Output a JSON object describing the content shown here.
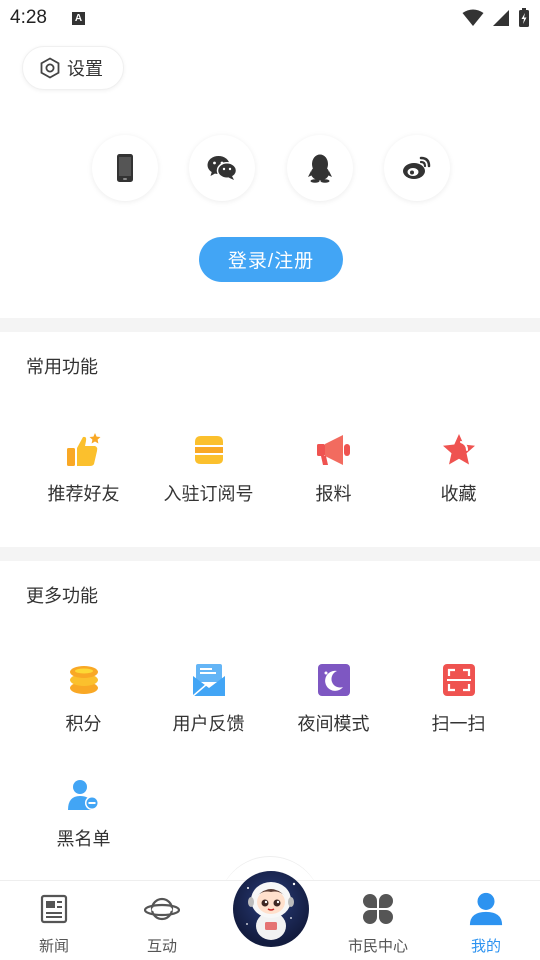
{
  "status_bar": {
    "time": "4:28",
    "notification_icon": "A"
  },
  "settings": {
    "label": "设置",
    "icon": "hexagon-gear-icon"
  },
  "social_logins": [
    {
      "name": "phone-icon"
    },
    {
      "name": "wechat-icon"
    },
    {
      "name": "qq-icon"
    },
    {
      "name": "weibo-icon"
    }
  ],
  "login_button": {
    "label": "登录/注册",
    "color": "#42a5f5"
  },
  "common_functions": {
    "title": "常用功能",
    "items": [
      {
        "label": "推荐好友",
        "icon": "thumbs-up-icon",
        "color": "#f9a825"
      },
      {
        "label": "入驻订阅号",
        "icon": "store-icon",
        "color": "#f9a825"
      },
      {
        "label": "报料",
        "icon": "megaphone-icon",
        "color": "#ef5350"
      },
      {
        "label": "收藏",
        "icon": "star-icon",
        "color": "#ef5350"
      }
    ]
  },
  "more_functions": {
    "title": "更多功能",
    "items": [
      {
        "label": "积分",
        "icon": "coins-icon",
        "color": "#f9a825"
      },
      {
        "label": "用户反馈",
        "icon": "feedback-mail-icon",
        "color": "#42a5f5"
      },
      {
        "label": "夜间模式",
        "icon": "moon-icon",
        "color": "#7e57c2"
      },
      {
        "label": "扫一扫",
        "icon": "scan-icon",
        "color": "#ef5350"
      },
      {
        "label": "黑名单",
        "icon": "blacklist-user-icon",
        "color": "#42a5f5"
      }
    ]
  },
  "bottom_nav": {
    "items": [
      {
        "label": "新闻",
        "icon": "newspaper-icon",
        "active": false
      },
      {
        "label": "互动",
        "icon": "planet-icon",
        "active": false
      },
      {
        "label": "市民中心",
        "icon": "clover-icon",
        "active": false
      },
      {
        "label": "我的",
        "icon": "user-icon",
        "active": true
      }
    ],
    "center": {
      "icon": "astronaut-mascot-icon"
    },
    "active_color": "#2d93f0"
  }
}
